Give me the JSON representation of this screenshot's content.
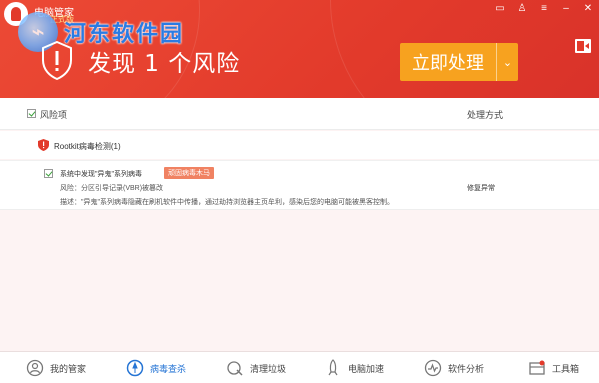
{
  "app": {
    "name": "电脑管家",
    "sub_badge": "正式版"
  },
  "watermark": {
    "text": "河东软件园"
  },
  "header": {
    "headline": "发现 1 个风险",
    "process_label": "立即处理",
    "process_arrow": "⌄"
  },
  "table": {
    "col_item": "风险项",
    "col_action": "处理方式"
  },
  "group": {
    "title": "Rootkit病毒检测(1)"
  },
  "detail": {
    "title": "系统中发现\"异鬼\"系列病毒",
    "tag": "顽固病毒木马",
    "risk": "风险：分区引导记录(VBR)被篡改",
    "desc": "描述：\"异鬼\"系列病毒隐藏在刷机软件中传播，通过劫持浏览器主页牟利，感染后您的电脑可能被黑客控制。",
    "action": "修复异常"
  },
  "bottom_nav": [
    {
      "label": "我的管家",
      "icon": "home-icon"
    },
    {
      "label": "病毒查杀",
      "icon": "virus-scan-icon"
    },
    {
      "label": "清理垃圾",
      "icon": "clean-icon"
    },
    {
      "label": "电脑加速",
      "icon": "rocket-icon"
    },
    {
      "label": "软件分析",
      "icon": "analysis-icon"
    },
    {
      "label": "工具箱",
      "icon": "toolbox-icon"
    }
  ],
  "colors": {
    "header_red": "#e23a2b",
    "button_orange": "#f7a21f",
    "active_blue": "#2574d4",
    "tag_red": "#f08262"
  }
}
